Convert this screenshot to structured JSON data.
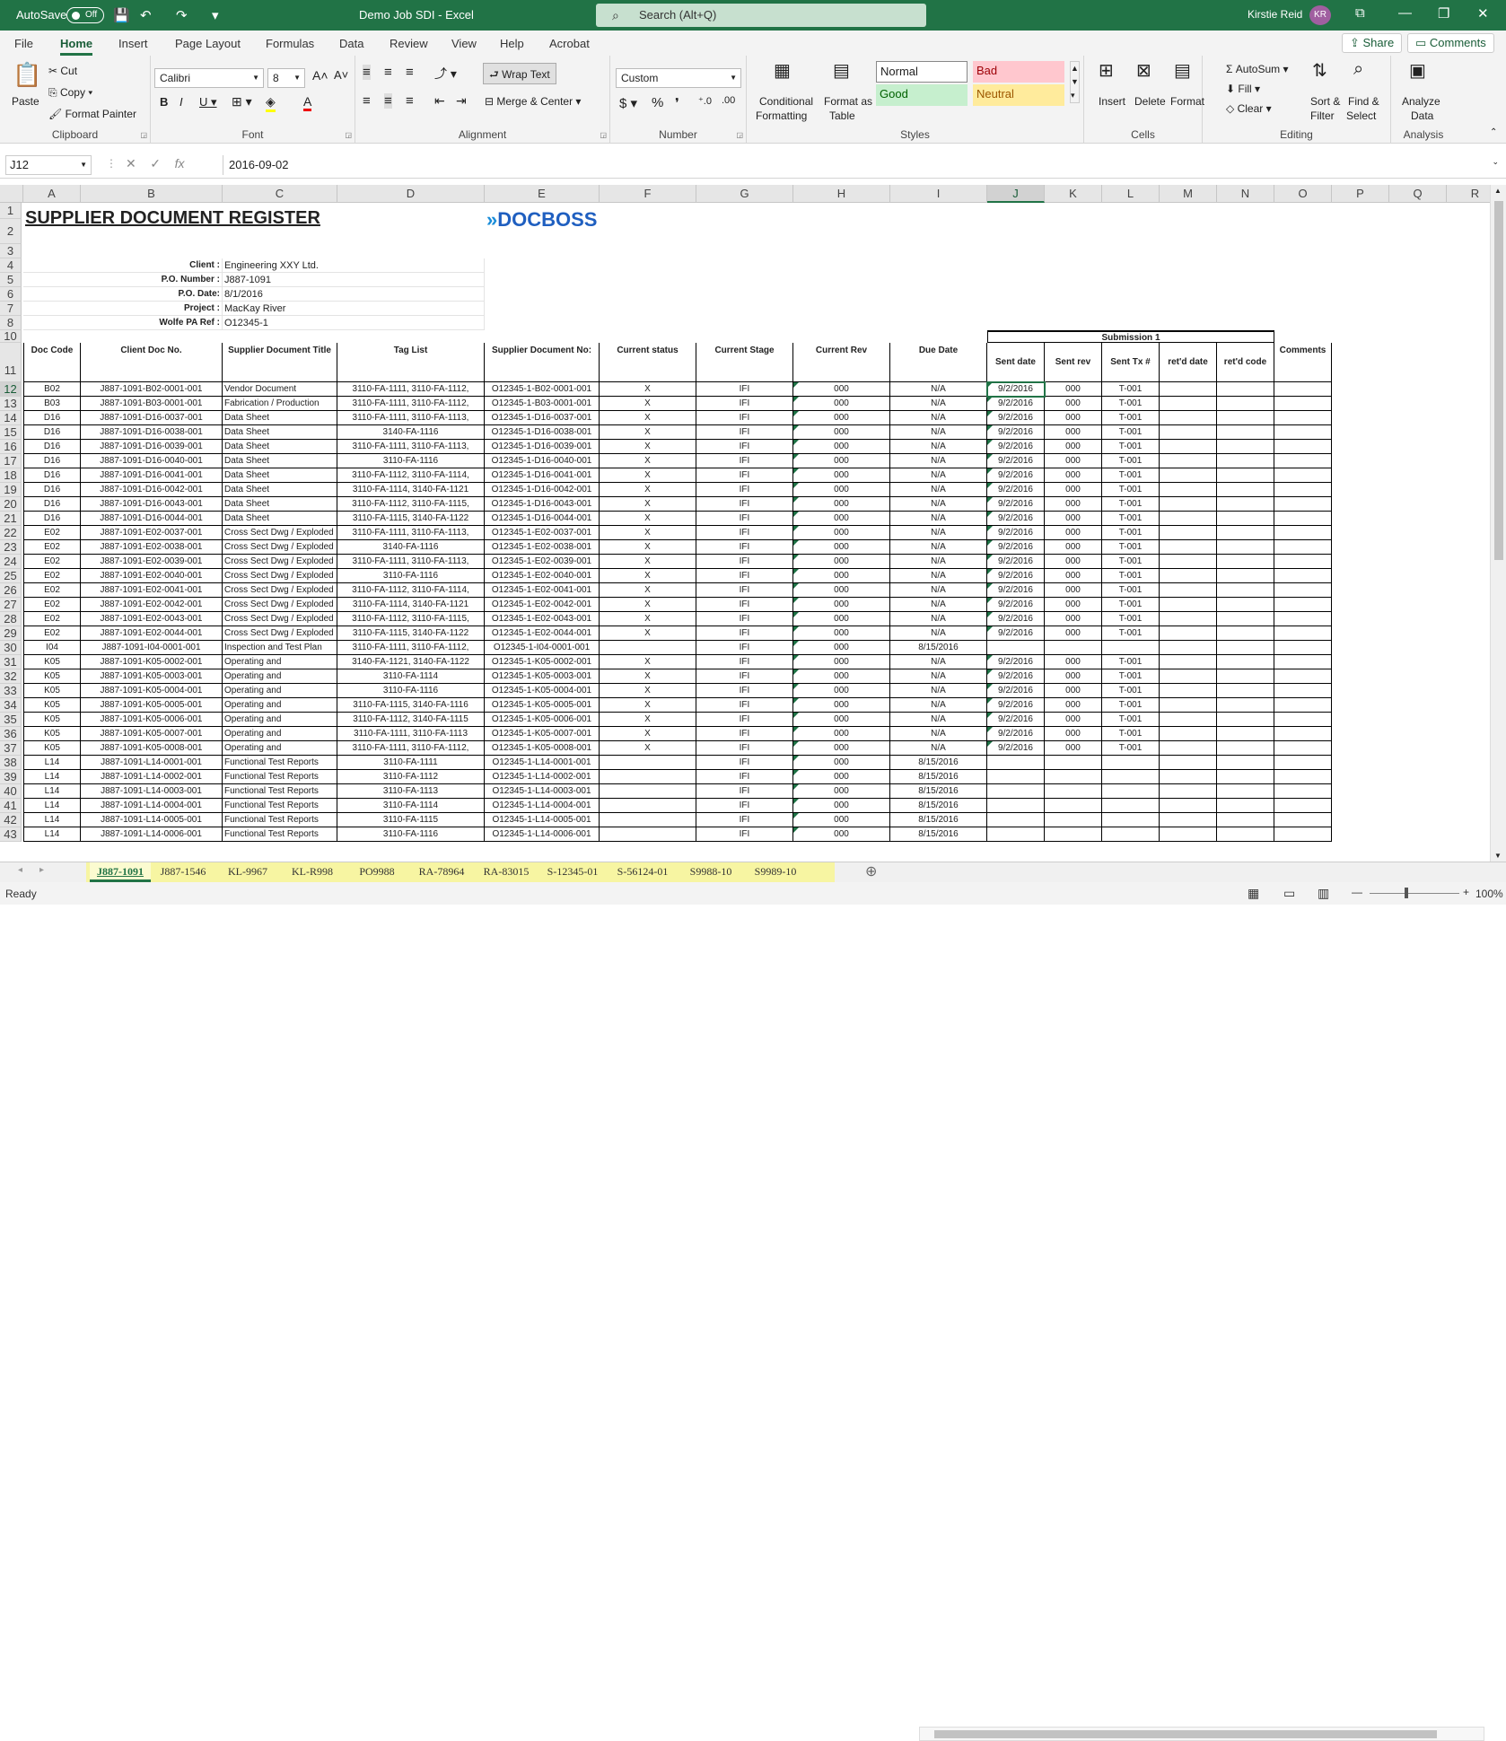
{
  "titlebar": {
    "autosave": "AutoSave",
    "autosave_state": "Off",
    "doc_title": "Demo Job SDI  -  Excel",
    "search": "Search (Alt+Q)",
    "user": "Kirstie Reid",
    "initials": "KR"
  },
  "ribbon_tabs": [
    "File",
    "Home",
    "Insert",
    "Page Layout",
    "Formulas",
    "Data",
    "Review",
    "View",
    "Help",
    "Acrobat"
  ],
  "share": "Share",
  "comments": "Comments",
  "clipboard": {
    "paste": "Paste",
    "cut": "Cut",
    "copy": "Copy",
    "format_painter": "Format Painter",
    "label": "Clipboard"
  },
  "font": {
    "name": "Calibri",
    "size": "8",
    "label": "Font"
  },
  "alignment": {
    "wrap": "Wrap Text",
    "merge": "Merge & Center",
    "label": "Alignment"
  },
  "number": {
    "format": "Custom",
    "label": "Number"
  },
  "styles": {
    "cond": "Conditional",
    "cond2": "Formatting",
    "fmt_table": "Format as",
    "fmt_table2": "Table",
    "normal": "Normal",
    "bad": "Bad",
    "good": "Good",
    "neutral": "Neutral",
    "label": "Styles"
  },
  "cells": {
    "insert": "Insert",
    "delete": "Delete",
    "format": "Format",
    "label": "Cells"
  },
  "editing": {
    "autosum": "AutoSum",
    "fill": "Fill",
    "clear": "Clear",
    "sort": "Sort &",
    "sort2": "Filter",
    "find": "Find &",
    "find2": "Select",
    "label": "Editing"
  },
  "analysis": {
    "analyze": "Analyze",
    "analyze2": "Data",
    "label": "Analysis"
  },
  "formula_bar": {
    "namebox": "J12",
    "fx": "fx",
    "value": "2016-09-02"
  },
  "columns": [
    "A",
    "B",
    "C",
    "D",
    "E",
    "F",
    "G",
    "H",
    "I",
    "J",
    "K",
    "L",
    "M",
    "N",
    "O",
    "P",
    "Q",
    "R"
  ],
  "rows": [
    "1",
    "2",
    "3",
    "4",
    "5",
    "6",
    "7",
    "8",
    "10",
    "11",
    "12",
    "13",
    "14",
    "15",
    "16",
    "17",
    "18",
    "19",
    "20",
    "21",
    "22",
    "23",
    "24",
    "25",
    "26",
    "27",
    "28",
    "29",
    "30",
    "31",
    "32",
    "33",
    "34",
    "35",
    "36",
    "37",
    "38",
    "39",
    "40",
    "41",
    "42",
    "43"
  ],
  "sheet": {
    "title": "SUPPLIER DOCUMENT REGISTER",
    "logo": "DOCBOSS",
    "meta": [
      [
        "Client :",
        "Engineering XXY Ltd."
      ],
      [
        "P.O. Number :",
        "J887-1091"
      ],
      [
        "P.O. Date:",
        "8/1/2016"
      ],
      [
        "Project :",
        "MacKay River"
      ],
      [
        "Wolfe PA Ref :",
        "O12345-1"
      ]
    ],
    "submission": "Submission 1",
    "headers": [
      "Doc Code",
      "Client Doc No.",
      "Supplier Document Title",
      "Tag List",
      "Supplier Document No:",
      "Current status",
      "Current Stage",
      "Current Rev",
      "Due Date",
      "Sent date",
      "Sent rev",
      "Sent Tx #",
      "ret'd date",
      "ret'd code",
      "Comments"
    ],
    "data": [
      [
        "B02",
        "J887-1091-B02-0001-001",
        "Vendor Document",
        "3110-FA-1111, 3110-FA-1112,",
        "O12345-1-B02-0001-001",
        "X",
        "IFI",
        "000",
        "N/A",
        "9/2/2016",
        "000",
        "T-001"
      ],
      [
        "B03",
        "J887-1091-B03-0001-001",
        "Fabrication / Production",
        "3110-FA-1111, 3110-FA-1112,",
        "O12345-1-B03-0001-001",
        "X",
        "IFI",
        "000",
        "N/A",
        "9/2/2016",
        "000",
        "T-001"
      ],
      [
        "D16",
        "J887-1091-D16-0037-001",
        "Data Sheet",
        "3110-FA-1111, 3110-FA-1113,",
        "O12345-1-D16-0037-001",
        "X",
        "IFI",
        "000",
        "N/A",
        "9/2/2016",
        "000",
        "T-001"
      ],
      [
        "D16",
        "J887-1091-D16-0038-001",
        "Data Sheet",
        "3140-FA-1116",
        "O12345-1-D16-0038-001",
        "X",
        "IFI",
        "000",
        "N/A",
        "9/2/2016",
        "000",
        "T-001"
      ],
      [
        "D16",
        "J887-1091-D16-0039-001",
        "Data Sheet",
        "3110-FA-1111, 3110-FA-1113,",
        "O12345-1-D16-0039-001",
        "X",
        "IFI",
        "000",
        "N/A",
        "9/2/2016",
        "000",
        "T-001"
      ],
      [
        "D16",
        "J887-1091-D16-0040-001",
        "Data Sheet",
        "3110-FA-1116",
        "O12345-1-D16-0040-001",
        "X",
        "IFI",
        "000",
        "N/A",
        "9/2/2016",
        "000",
        "T-001"
      ],
      [
        "D16",
        "J887-1091-D16-0041-001",
        "Data Sheet",
        "3110-FA-1112, 3110-FA-1114,",
        "O12345-1-D16-0041-001",
        "X",
        "IFI",
        "000",
        "N/A",
        "9/2/2016",
        "000",
        "T-001"
      ],
      [
        "D16",
        "J887-1091-D16-0042-001",
        "Data Sheet",
        "3110-FA-1114, 3140-FA-1121",
        "O12345-1-D16-0042-001",
        "X",
        "IFI",
        "000",
        "N/A",
        "9/2/2016",
        "000",
        "T-001"
      ],
      [
        "D16",
        "J887-1091-D16-0043-001",
        "Data Sheet",
        "3110-FA-1112, 3110-FA-1115,",
        "O12345-1-D16-0043-001",
        "X",
        "IFI",
        "000",
        "N/A",
        "9/2/2016",
        "000",
        "T-001"
      ],
      [
        "D16",
        "J887-1091-D16-0044-001",
        "Data Sheet",
        "3110-FA-1115, 3140-FA-1122",
        "O12345-1-D16-0044-001",
        "X",
        "IFI",
        "000",
        "N/A",
        "9/2/2016",
        "000",
        "T-001"
      ],
      [
        "E02",
        "J887-1091-E02-0037-001",
        "Cross Sect Dwg / Exploded",
        "3110-FA-1111, 3110-FA-1113,",
        "O12345-1-E02-0037-001",
        "X",
        "IFI",
        "000",
        "N/A",
        "9/2/2016",
        "000",
        "T-001"
      ],
      [
        "E02",
        "J887-1091-E02-0038-001",
        "Cross Sect Dwg / Exploded",
        "3140-FA-1116",
        "O12345-1-E02-0038-001",
        "X",
        "IFI",
        "000",
        "N/A",
        "9/2/2016",
        "000",
        "T-001"
      ],
      [
        "E02",
        "J887-1091-E02-0039-001",
        "Cross Sect Dwg / Exploded",
        "3110-FA-1111, 3110-FA-1113,",
        "O12345-1-E02-0039-001",
        "X",
        "IFI",
        "000",
        "N/A",
        "9/2/2016",
        "000",
        "T-001"
      ],
      [
        "E02",
        "J887-1091-E02-0040-001",
        "Cross Sect Dwg / Exploded",
        "3110-FA-1116",
        "O12345-1-E02-0040-001",
        "X",
        "IFI",
        "000",
        "N/A",
        "9/2/2016",
        "000",
        "T-001"
      ],
      [
        "E02",
        "J887-1091-E02-0041-001",
        "Cross Sect Dwg / Exploded",
        "3110-FA-1112, 3110-FA-1114,",
        "O12345-1-E02-0041-001",
        "X",
        "IFI",
        "000",
        "N/A",
        "9/2/2016",
        "000",
        "T-001"
      ],
      [
        "E02",
        "J887-1091-E02-0042-001",
        "Cross Sect Dwg / Exploded",
        "3110-FA-1114, 3140-FA-1121",
        "O12345-1-E02-0042-001",
        "X",
        "IFI",
        "000",
        "N/A",
        "9/2/2016",
        "000",
        "T-001"
      ],
      [
        "E02",
        "J887-1091-E02-0043-001",
        "Cross Sect Dwg / Exploded",
        "3110-FA-1112, 3110-FA-1115,",
        "O12345-1-E02-0043-001",
        "X",
        "IFI",
        "000",
        "N/A",
        "9/2/2016",
        "000",
        "T-001"
      ],
      [
        "E02",
        "J887-1091-E02-0044-001",
        "Cross Sect Dwg / Exploded",
        "3110-FA-1115, 3140-FA-1122",
        "O12345-1-E02-0044-001",
        "X",
        "IFI",
        "000",
        "N/A",
        "9/2/2016",
        "000",
        "T-001"
      ],
      [
        "I04",
        "J887-1091-I04-0001-001",
        "Inspection and Test Plan",
        "3110-FA-1111, 3110-FA-1112,",
        "O12345-1-I04-0001-001",
        "",
        "IFI",
        "000",
        "8/15/2016",
        "",
        "",
        ""
      ],
      [
        "K05",
        "J887-1091-K05-0002-001",
        "Operating and",
        "3140-FA-1121, 3140-FA-1122",
        "O12345-1-K05-0002-001",
        "X",
        "IFI",
        "000",
        "N/A",
        "9/2/2016",
        "000",
        "T-001"
      ],
      [
        "K05",
        "J887-1091-K05-0003-001",
        "Operating and",
        "3110-FA-1114",
        "O12345-1-K05-0003-001",
        "X",
        "IFI",
        "000",
        "N/A",
        "9/2/2016",
        "000",
        "T-001"
      ],
      [
        "K05",
        "J887-1091-K05-0004-001",
        "Operating and",
        "3110-FA-1116",
        "O12345-1-K05-0004-001",
        "X",
        "IFI",
        "000",
        "N/A",
        "9/2/2016",
        "000",
        "T-001"
      ],
      [
        "K05",
        "J887-1091-K05-0005-001",
        "Operating and",
        "3110-FA-1115, 3140-FA-1116",
        "O12345-1-K05-0005-001",
        "X",
        "IFI",
        "000",
        "N/A",
        "9/2/2016",
        "000",
        "T-001"
      ],
      [
        "K05",
        "J887-1091-K05-0006-001",
        "Operating and",
        "3110-FA-1112, 3140-FA-1115",
        "O12345-1-K05-0006-001",
        "X",
        "IFI",
        "000",
        "N/A",
        "9/2/2016",
        "000",
        "T-001"
      ],
      [
        "K05",
        "J887-1091-K05-0007-001",
        "Operating and",
        "3110-FA-1111, 3110-FA-1113",
        "O12345-1-K05-0007-001",
        "X",
        "IFI",
        "000",
        "N/A",
        "9/2/2016",
        "000",
        "T-001"
      ],
      [
        "K05",
        "J887-1091-K05-0008-001",
        "Operating and",
        "3110-FA-1111, 3110-FA-1112,",
        "O12345-1-K05-0008-001",
        "X",
        "IFI",
        "000",
        "N/A",
        "9/2/2016",
        "000",
        "T-001"
      ],
      [
        "L14",
        "J887-1091-L14-0001-001",
        "Functional Test Reports",
        "3110-FA-1111",
        "O12345-1-L14-0001-001",
        "",
        "IFI",
        "000",
        "8/15/2016",
        "",
        "",
        ""
      ],
      [
        "L14",
        "J887-1091-L14-0002-001",
        "Functional Test Reports",
        "3110-FA-1112",
        "O12345-1-L14-0002-001",
        "",
        "IFI",
        "000",
        "8/15/2016",
        "",
        "",
        ""
      ],
      [
        "L14",
        "J887-1091-L14-0003-001",
        "Functional Test Reports",
        "3110-FA-1113",
        "O12345-1-L14-0003-001",
        "",
        "IFI",
        "000",
        "8/15/2016",
        "",
        "",
        ""
      ],
      [
        "L14",
        "J887-1091-L14-0004-001",
        "Functional Test Reports",
        "3110-FA-1114",
        "O12345-1-L14-0004-001",
        "",
        "IFI",
        "000",
        "8/15/2016",
        "",
        "",
        ""
      ],
      [
        "L14",
        "J887-1091-L14-0005-001",
        "Functional Test Reports",
        "3110-FA-1115",
        "O12345-1-L14-0005-001",
        "",
        "IFI",
        "000",
        "8/15/2016",
        "",
        "",
        ""
      ],
      [
        "L14",
        "J887-1091-L14-0006-001",
        "Functional Test Reports",
        "3110-FA-1116",
        "O12345-1-L14-0006-001",
        "",
        "IFI",
        "000",
        "8/15/2016",
        "",
        "",
        ""
      ]
    ]
  },
  "sheet_tabs": [
    "J887-1091",
    "J887-1546",
    "KL-9967",
    "KL-R998",
    "PO9988",
    "RA-78964",
    "RA-83015",
    "S-12345-01",
    "S-56124-01",
    "S9988-10",
    "S9989-10"
  ],
  "status": {
    "ready": "Ready",
    "zoom": "100%"
  },
  "colors": {
    "excel_green": "#217346",
    "tab_highlight": "#f7f5a2",
    "bad_bg": "#ffc7ce",
    "good_bg": "#c6efce",
    "neutral_bg": "#ffeb9c"
  }
}
